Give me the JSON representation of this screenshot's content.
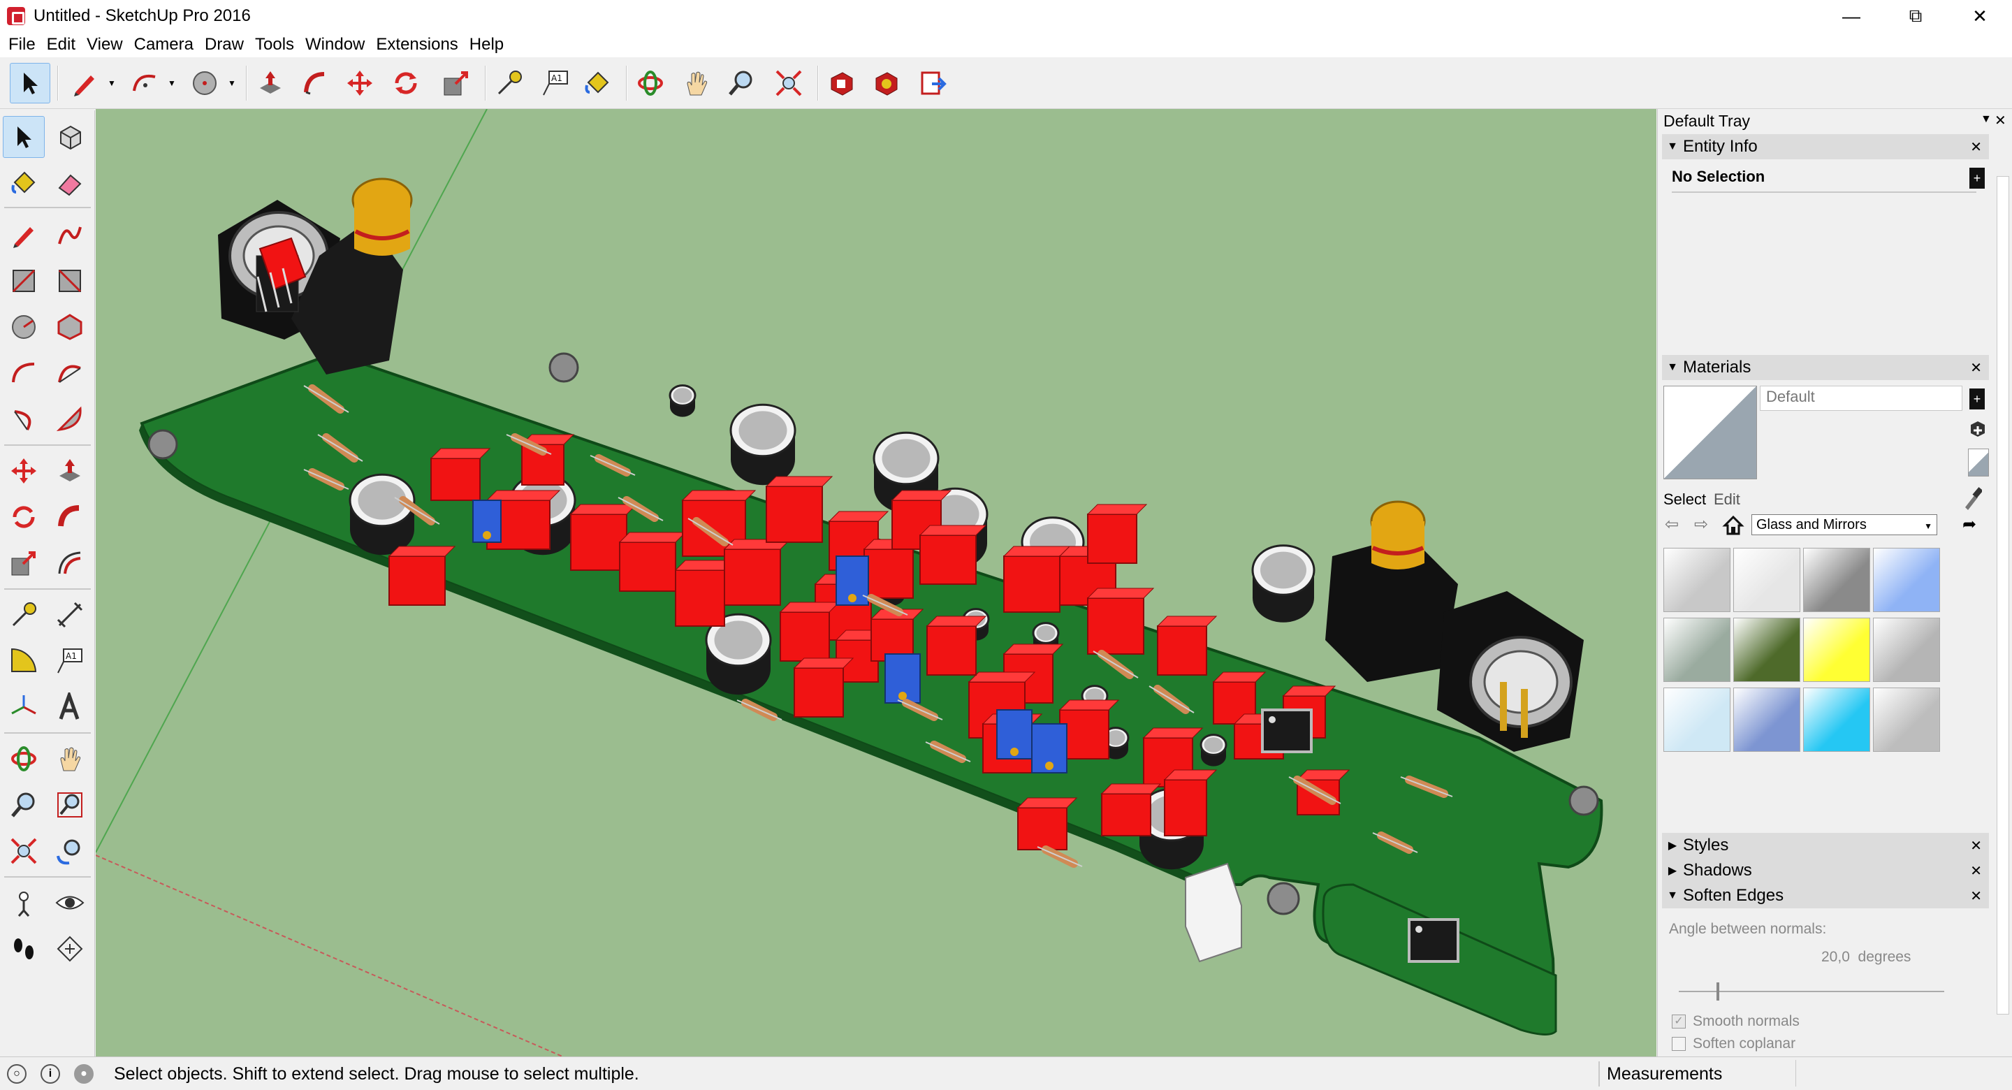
{
  "window": {
    "title": "Untitled - SketchUp Pro 2016"
  },
  "menu": [
    "File",
    "Edit",
    "View",
    "Camera",
    "Draw",
    "Tools",
    "Window",
    "Extensions",
    "Help"
  ],
  "tray": {
    "title": "Default Tray",
    "entity_info": {
      "header": "Entity Info",
      "selection": "No Selection"
    },
    "materials": {
      "header": "Materials",
      "name_value": "Default",
      "tabs": [
        "Select",
        "Edit"
      ],
      "collection": "Glass and Mirrors",
      "swatches": [
        {
          "name": "glass-gray-1",
          "color": "#c8c8c8"
        },
        {
          "name": "glass-gray-2",
          "color": "#e6e6e6"
        },
        {
          "name": "glass-block",
          "color": "#8a8a8a"
        },
        {
          "name": "glass-blue",
          "color": "#8fb3f5"
        },
        {
          "name": "glass-green-pattern",
          "color": "#9aab9f"
        },
        {
          "name": "glass-dark-green",
          "color": "#4e6a2a"
        },
        {
          "name": "glass-yellow",
          "color": "#ffff33"
        },
        {
          "name": "glass-gray-3",
          "color": "#b5b5b5"
        },
        {
          "name": "glass-light-blue-grid",
          "color": "#cfe8f5"
        },
        {
          "name": "glass-sky",
          "color": "#7d95d2"
        },
        {
          "name": "glass-cyan",
          "color": "#25c7f3"
        },
        {
          "name": "glass-noise",
          "color": "#bdbdbd"
        }
      ]
    },
    "styles": {
      "header": "Styles"
    },
    "shadows": {
      "header": "Shadows"
    },
    "soften_edges": {
      "header": "Soften Edges",
      "angle_label": "Angle between normals:",
      "angle_value": "20,0",
      "angle_unit": "degrees",
      "smooth_normals": "Smooth normals",
      "soften_coplanar": "Soften coplanar"
    }
  },
  "status": {
    "message": "Select objects. Shift to extend select. Drag mouse to select multiple.",
    "measurements_label": "Measurements"
  },
  "colors": {
    "viewport_bg": "#9bbd8f",
    "pcb_green": "#1f7a2c",
    "component_red": "#f11313",
    "trimmer_blue": "#2f5fd8",
    "capacitor_black": "#1a1a1a",
    "connector_yellow": "#e2a613"
  }
}
